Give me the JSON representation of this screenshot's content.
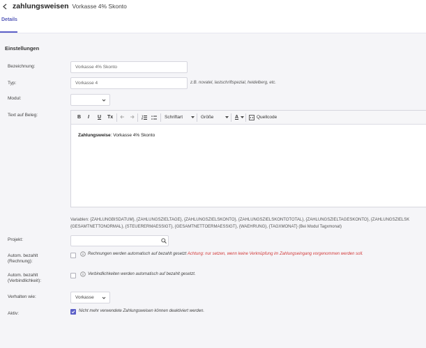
{
  "header": {
    "title": "zahlungsweisen",
    "subtitle": "Vorkasse 4% Skonto",
    "tab": "Details"
  },
  "section": {
    "title": "Einstellungen"
  },
  "form": {
    "bezeichnung": {
      "label": "Bezeichnung:",
      "value": "Vorkasse 4% Skonto"
    },
    "typ": {
      "label": "Typ:",
      "value": "Vorkasse 4",
      "hint": "z.B. novatel, lastschriftspezial, heidelberg, etc."
    },
    "modul": {
      "label": "Modul:",
      "value": ""
    },
    "text_beleg": {
      "label": "Text auf Beleg:"
    },
    "projekt": {
      "label": "Projekt:",
      "value": ""
    },
    "autom_rechnung": {
      "label_line1": "Autom. bezahlt",
      "label_line2": "(Rechnung):",
      "desc": "Rechnungen werden automatisch auf bezahlt gesetzt",
      "warning": "Achtung: nur setzen, wenn keine Verknüpfung im Zahlungseingang vorgenommen werden soll."
    },
    "autom_verbindlichkeit": {
      "label_line1": "Autom. bezahlt",
      "label_line2": "(Verbindlichkeit):",
      "desc": "Verbindlichkeiten werden automatisch auf bezahlt gesetzt."
    },
    "verhalten": {
      "label": "Verhalten wie:",
      "value": "Vorkasse"
    },
    "aktiv": {
      "label": "Aktiv:",
      "desc": "Nicht mehr verwendete Zahlungsweisen können deaktiviert werden.",
      "checked": true
    }
  },
  "editor": {
    "toolbar": {
      "bold": "B",
      "italic": "I",
      "underline": "U",
      "clear": "Tx",
      "font": "Schriftart",
      "size": "Größe",
      "color": "A",
      "source": "Quellcode"
    },
    "content_bold": "Zahlungsweise",
    "content_rest": ": Vorkasse 4% Skonto"
  },
  "variables": {
    "line1": "Variablen: {ZAHLUNGBISDATUM}, {ZAHLUNGSZIELTAGE}, {ZAHLUNGSZIELSKONTO}, {ZAHLUNGSZIELSKONTOTOTAL}, {ZAHLUNGSZIELTAGESKONTO}, {ZAHLUNGSZIELSK",
    "line2": "{GESAMTNETTONORMAL}, {STEUERERMAESSIGT}, {GESAMTNETTOERMAESSIGT}, {WAEHRUNG}, {TAGXMONAT} (Bei Modul Tagxmonat)"
  }
}
